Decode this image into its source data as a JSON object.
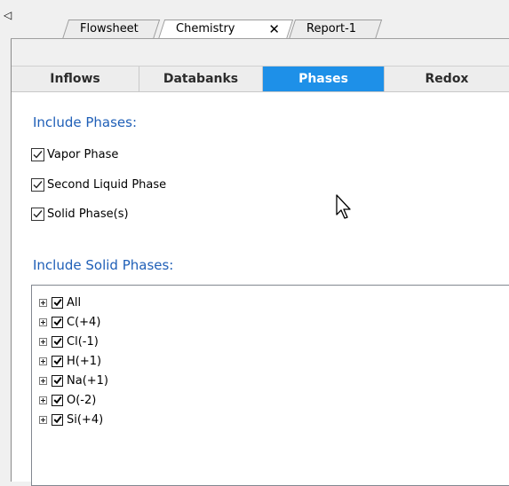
{
  "document_tabs": [
    {
      "label": "Flowsheet",
      "active": false
    },
    {
      "label": "Chemistry",
      "active": true,
      "close_glyph": "✕"
    },
    {
      "label": "Report-1",
      "active": false
    }
  ],
  "tab_scroll_glyph": "◁",
  "sub_tabs": [
    {
      "label": "Inflows",
      "active": false
    },
    {
      "label": "Databanks",
      "active": false
    },
    {
      "label": "Phases",
      "active": true
    },
    {
      "label": "Redox",
      "active": false
    }
  ],
  "include_phases": {
    "title": "Include Phases:",
    "options": [
      {
        "label": "Vapor Phase",
        "checked": true
      },
      {
        "label": "Second Liquid Phase",
        "checked": true
      },
      {
        "label": "Solid Phase(s)",
        "checked": true
      }
    ]
  },
  "include_solid_phases": {
    "title": "Include Solid Phases:",
    "items": [
      {
        "label": "All",
        "checked": true
      },
      {
        "label": "C(+4)",
        "checked": true
      },
      {
        "label": "Cl(-1)",
        "checked": true
      },
      {
        "label": "H(+1)",
        "checked": true
      },
      {
        "label": "Na(+1)",
        "checked": true
      },
      {
        "label": "O(-2)",
        "checked": true
      },
      {
        "label": "Si(+4)",
        "checked": true
      }
    ]
  },
  "colors": {
    "active_subtab": "#1e90e8",
    "section_title": "#1f5fb7"
  },
  "icons": {
    "cursor": "mouse-pointer-icon",
    "expander": "plus-box-icon",
    "check": "checkmark-icon",
    "close": "close-icon",
    "scroll": "triangle-left-icon"
  }
}
